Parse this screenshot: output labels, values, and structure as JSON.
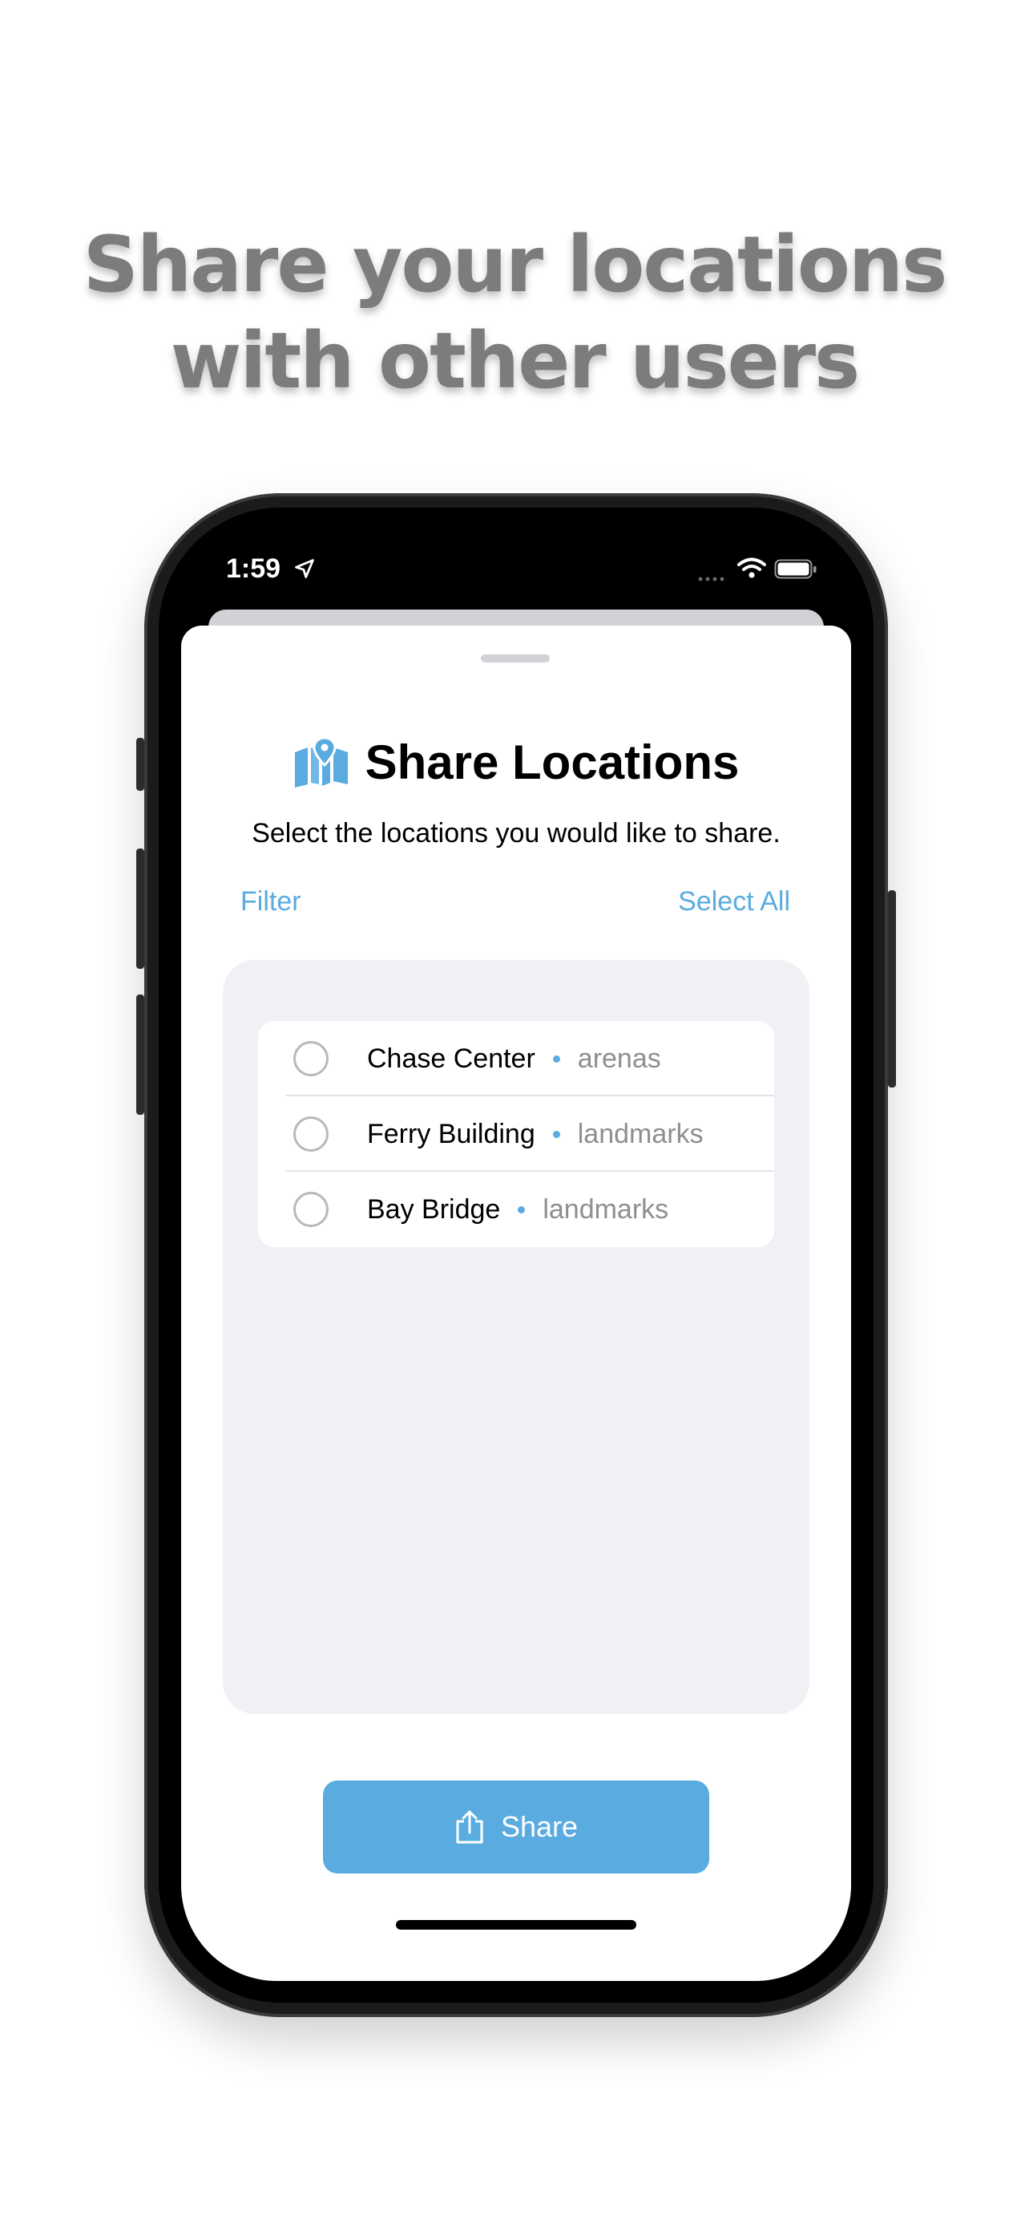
{
  "headline": {
    "line1": "Share your locations",
    "line2": "with other users"
  },
  "status_bar": {
    "time": "1:59",
    "icons": [
      "location-arrow-icon",
      "signal-icon",
      "wifi-icon",
      "battery-icon"
    ]
  },
  "sheet": {
    "title": "Share Locations",
    "title_icon": "map-icon",
    "subtitle": "Select the locations you would like to share.",
    "filter_label": "Filter",
    "select_all_label": "Select All",
    "locations": [
      {
        "name": "Chase Center",
        "category": "arenas"
      },
      {
        "name": "Ferry Building",
        "category": "landmarks"
      },
      {
        "name": "Bay Bridge",
        "category": "landmarks"
      }
    ],
    "share_label": "Share",
    "share_icon": "share-icon"
  },
  "colors": {
    "accent": "#5aabe0",
    "headline": "#7c7c7c",
    "list_background": "#f1f1f5",
    "secondary_text": "#8e8e93"
  }
}
